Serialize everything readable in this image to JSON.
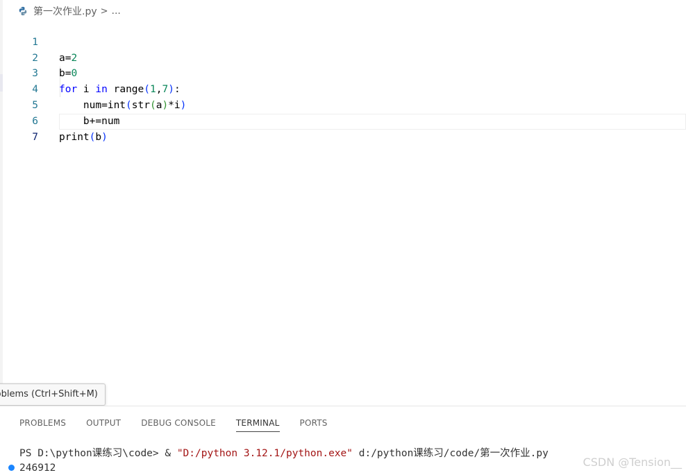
{
  "breadcrumb": {
    "file_name": "第一次作业.py",
    "separator": ">",
    "more": "...",
    "file_icon": "python-file-icon"
  },
  "editor": {
    "lines": [
      {
        "number": "1"
      },
      {
        "number": "2"
      },
      {
        "number": "3"
      },
      {
        "number": "4"
      },
      {
        "number": "5"
      },
      {
        "number": "6"
      },
      {
        "number": "7"
      }
    ],
    "tokens": {
      "l1_a": "a=",
      "l1_2": "2",
      "l2_b": "b=",
      "l2_0": "0",
      "l3_for": "for",
      "l3_i": " i ",
      "l3_in": "in",
      "l3_range": " range",
      "l3_open": "(",
      "l3_1": "1",
      "l3_comma": ",",
      "l3_7": "7",
      "l3_close": ")",
      "l3_colon": ":",
      "l4_indent": "    ",
      "l4_num": "num=int",
      "l4_open1": "(",
      "l4_str": "str",
      "l4_open2": "(",
      "l4_a": "a",
      "l4_close2": ")",
      "l4_mul": "*i",
      "l4_close1": ")",
      "l5_indent": "    ",
      "l5_code": "b+=num",
      "l6_print": "print",
      "l6_open": "(",
      "l6_b": "b",
      "l6_close": ")"
    }
  },
  "tooltip": {
    "text": "Problems (Ctrl+Shift+M)"
  },
  "panel": {
    "tabs": [
      {
        "label": "PROBLEMS"
      },
      {
        "label": "OUTPUT"
      },
      {
        "label": "DEBUG CONSOLE"
      },
      {
        "label": "TERMINAL"
      },
      {
        "label": "PORTS"
      }
    ],
    "active_tab": "TERMINAL",
    "terminal": {
      "prompt": "PS D:\\python课练习\\code> & ",
      "exe": "\"D:/python 3.12.1/python.exe\"",
      "arg": " d:/python课练习/code/第一次作业.py",
      "output": "246912"
    }
  },
  "watermark": "CSDN @Tension__",
  "colors": {
    "line_number": "#237893",
    "keyword": "#0000ff",
    "number": "#098658",
    "string": "#a31515",
    "status_dot": "#1a85ff"
  }
}
